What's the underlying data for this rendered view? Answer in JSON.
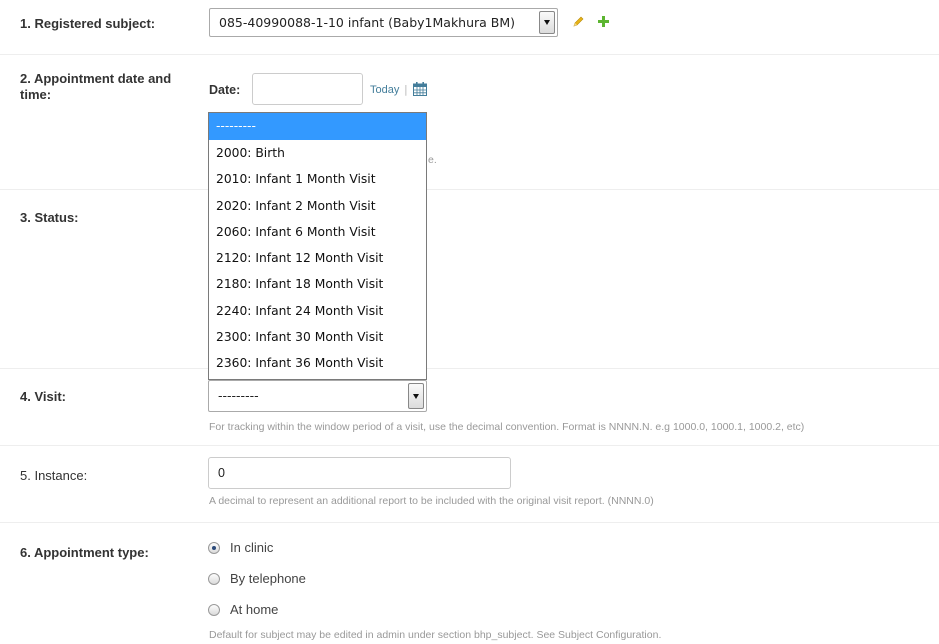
{
  "form": {
    "registered_subject": {
      "label": "1. Registered subject:",
      "value": "085-40990088-1-10 infant (Baby1Makhura BM)"
    },
    "appointment_datetime": {
      "label_line1": "2. Appointment date and",
      "label_line2": "time:",
      "date_label": "Date:",
      "date_value": "",
      "today_link": "Today",
      "separator": "|",
      "help_fragment": "e."
    },
    "status": {
      "label": "3. Status:"
    },
    "visit": {
      "label": "4. Visit:",
      "value": "---------",
      "help": "For tracking within the window period of a visit, use the decimal convention. Format is NNNN.N. e.g 1000.0, 1000.1, 1000.2, etc)",
      "options": [
        "---------",
        "2000: Birth",
        "2010: Infant 1 Month Visit",
        "2020: Infant 2 Month Visit",
        "2060: Infant 6 Month Visit",
        "2120: Infant 12 Month Visit",
        "2180: Infant 18 Month Visit",
        "2240: Infant 24 Month Visit",
        "2300: Infant 30 Month Visit",
        "2360: Infant 36 Month Visit"
      ]
    },
    "instance": {
      "label": "5. Instance:",
      "value": "0",
      "help": "A decimal to represent an additional report to be included with the original visit report. (NNNN.0)"
    },
    "appointment_type": {
      "label": "6. Appointment type:",
      "options": [
        "In clinic",
        "By telephone",
        "At home"
      ],
      "selected": "In clinic",
      "help": "Default for subject may be edited in admin under section bhp_subject. See Subject Configuration."
    }
  },
  "colors": {
    "highlight": "#3399ff",
    "link": "#447e9b",
    "edit_icon": "#e8b417",
    "add_icon": "#5cb531"
  },
  "icons": [
    "pencil-icon",
    "plus-icon",
    "calendar-icon"
  ]
}
